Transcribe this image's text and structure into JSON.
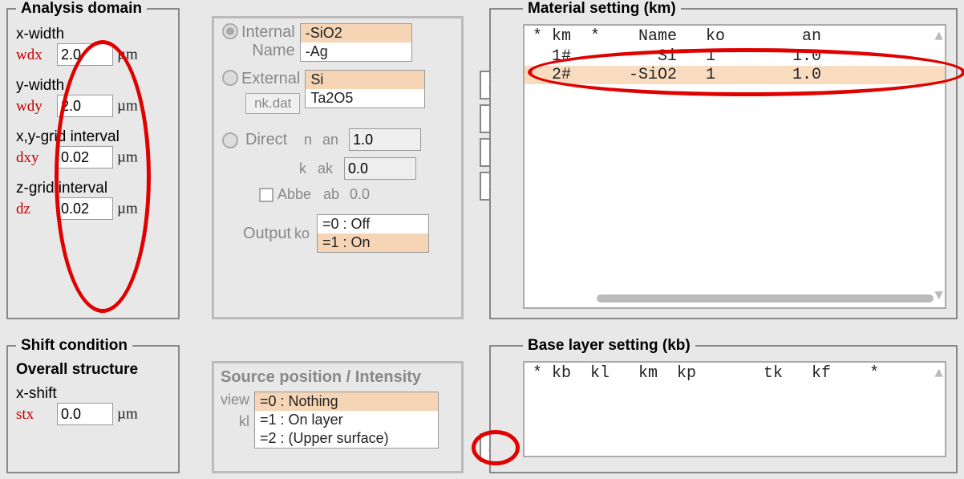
{
  "analysis": {
    "legend": "Analysis domain",
    "x_width_label": "x-width",
    "wdx_label": "wdx",
    "wdx_value": "2.0",
    "unit_um": "µm",
    "y_width_label": "y-width",
    "wdy_label": "wdy",
    "wdy_value": "2.0",
    "xy_grid_label": "x,y-grid interval",
    "dxy_label": "dxy",
    "dxy_value": "0.02",
    "z_grid_label": "z-grid interval",
    "dz_label": "dz",
    "dz_value": "0.02"
  },
  "middle_panel": {
    "internal_label": "Internal",
    "name_label": "Name",
    "internal_opt1": "-SiO2",
    "internal_opt2": "-Ag",
    "external_label": "External",
    "external_opt1": "Si",
    "external_opt2": "Ta2O5",
    "nkdat_btn": "nk.dat",
    "direct_label": "Direct",
    "n_label": "n",
    "an_label": "an",
    "an_value": "1.0",
    "k_label": "k",
    "ak_label": "ak",
    "ak_value": "0.0",
    "abbe_label": "Abbe",
    "ab_label": "ab",
    "ab_value": "0.0",
    "output_label": "Output",
    "ko_label": "ko",
    "output_opt1": "=0 : Off",
    "output_opt2": "=1 : On"
  },
  "nav": {
    "left_arrow": "←",
    "up_triangle": "▲",
    "down_triangle": "▼",
    "x_mark": "✕"
  },
  "materials": {
    "legend": "Material setting (km)",
    "header": "* km  *    Name   ko        an",
    "rows": [
      {
        "text": "  1#         Si   1        1.0",
        "sel": false
      },
      {
        "text": "  2#      -SiO2   1        1.0",
        "sel": true
      }
    ]
  },
  "shift": {
    "legend": "Shift condition",
    "overall_label": "Overall structure",
    "xshift_label": "x-shift",
    "stx_label": "stx",
    "stx_value": "0.0"
  },
  "source_panel": {
    "title": "Source position / Intensity",
    "view_label": "view",
    "kl_label": "kl",
    "opt1": "=0 : Nothing",
    "opt2": "=1 : On layer",
    "opt3": "=2 : (Upper surface)"
  },
  "base_layer": {
    "legend": "Base layer setting (kb)",
    "header": "* kb  kl   km  kp       tk   kf    *",
    "left_arrow": "←"
  }
}
